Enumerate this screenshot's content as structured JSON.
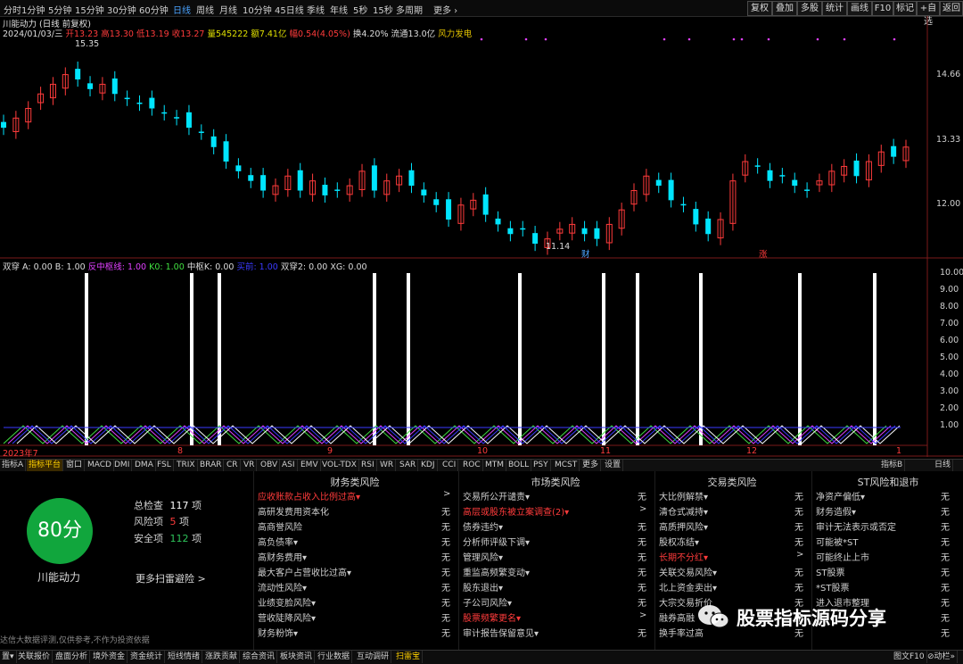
{
  "topbar": {
    "timeframes": [
      "分时",
      "1分钟",
      "5分钟",
      "15分钟",
      "30分钟",
      "60分钟",
      "日线",
      "周线",
      "月线",
      "10分钟",
      "45日线",
      "季线",
      "年线",
      "5秒",
      "15秒",
      "多周期",
      "更多 ›"
    ],
    "right_buttons": [
      "复权",
      "叠加",
      "多股",
      "统计",
      "画线",
      "F10",
      "标记",
      "+自选",
      "返回"
    ]
  },
  "header": {
    "name_line": "川能动力 (日线 前复权)",
    "date": "2024/01/03/三",
    "open_label": "开",
    "open": "13.23",
    "high_label": "高",
    "high": "13.30",
    "low_label": "低",
    "low": "13.19",
    "close_label": "收",
    "close": "13.27",
    "vol_label": "量",
    "vol": "545222",
    "amt_label": "额",
    "amt": "7.41亿",
    "chg_label": "幅",
    "chg": "0.54(4.05%)",
    "turn": "换4.20%",
    "float": "流通13.0亿",
    "concept": "风力发电"
  },
  "price_axis": [
    "14.66",
    "13.33",
    "12.00"
  ],
  "price_marks": {
    "high": "15.35",
    "low": "11.14",
    "tag_cai": "财",
    "tag_zhang": "涨"
  },
  "date_axis": [
    "2023年7",
    "8",
    "9",
    "10",
    "11",
    "12",
    "1"
  ],
  "indicator": {
    "name": "双穿",
    "legend": [
      "A: 0.00",
      "B: 1.00",
      "反中枢线: 1.00",
      "K0: 1.00",
      "中枢K: 0.00",
      "买前: 1.00",
      "双穿2: 0.00",
      "XG: 0.00"
    ],
    "axis": [
      "10.00",
      "9.00",
      "8.00",
      "7.00",
      "6.00",
      "5.00",
      "4.00",
      "3.00",
      "2.00",
      "1.00"
    ]
  },
  "tabs": [
    "指标A",
    "指标平台",
    "窗口",
    "MACD",
    "DMI",
    "DMA",
    "FSL",
    "TRIX",
    "BRAR",
    "CR",
    "VR",
    "OBV",
    "ASI",
    "EMV",
    "VOL-TDX",
    "RSI",
    "WR",
    "SAR",
    "KDJ",
    "CCI",
    "ROC",
    "MTM",
    "BOLL",
    "PSY",
    "MCST",
    "更多",
    "设置"
  ],
  "tabs_right": [
    "指标B",
    "日线"
  ],
  "risk": {
    "score": "80分",
    "company": "川能动力",
    "total_label": "总检查",
    "total": "117",
    "unit": "项",
    "risk_label": "风险项",
    "risk_count": "5",
    "safe_label": "安全项",
    "safe": "112",
    "more": "更多扫雷避险 >",
    "disclaimer": "达信大数据评测,仅供参考,不作为投资依据",
    "columns": [
      {
        "title": "财务类风险",
        "rows": [
          {
            "label": "应收账款占收入比例过高▾",
            "val": ">",
            "red": true
          },
          {
            "label": "高研发费用资本化",
            "val": "无"
          },
          {
            "label": "高商誉风险",
            "val": "无"
          },
          {
            "label": "高负债率▾",
            "val": "无"
          },
          {
            "label": "高财务费用▾",
            "val": "无"
          },
          {
            "label": "最大客户占营收比过高▾",
            "val": "无"
          },
          {
            "label": "流动性风险▾",
            "val": "无"
          },
          {
            "label": "业绩变脸风险▾",
            "val": "无"
          },
          {
            "label": "营收陡降风险▾",
            "val": "无"
          },
          {
            "label": "财务粉饰▾",
            "val": "无"
          }
        ]
      },
      {
        "title": "市场类风险",
        "rows": [
          {
            "label": "交易所公开谴责▾",
            "val": "无"
          },
          {
            "label": "高层或股东被立案调查(2)▾",
            "val": ">",
            "red": true
          },
          {
            "label": "债券违约▾",
            "val": "无"
          },
          {
            "label": "分析师评级下调▾",
            "val": "无"
          },
          {
            "label": "管理风险▾",
            "val": "无"
          },
          {
            "label": "重监高频繁变动▾",
            "val": "无"
          },
          {
            "label": "股东退出▾",
            "val": "无"
          },
          {
            "label": "子公司风险▾",
            "val": "无"
          },
          {
            "label": "股票频繁更名▾",
            "val": ">",
            "red": true
          },
          {
            "label": "审计报告保留意见▾",
            "val": "无"
          }
        ]
      },
      {
        "title": "交易类风险",
        "rows": [
          {
            "label": "大比例解禁▾",
            "val": "无"
          },
          {
            "label": "清仓式减持▾",
            "val": "无"
          },
          {
            "label": "高质押风险▾",
            "val": "无"
          },
          {
            "label": "股权冻结▾",
            "val": "无"
          },
          {
            "label": "长期不分红▾",
            "val": ">",
            "red": true
          },
          {
            "label": "关联交易风险▾",
            "val": "无"
          },
          {
            "label": "北上资金卖出▾",
            "val": "无"
          },
          {
            "label": "大宗交易折价",
            "val": "无"
          },
          {
            "label": "融券高融",
            "val": "无"
          },
          {
            "label": "换手率过高",
            "val": "无"
          }
        ]
      },
      {
        "title": "ST风险和退市",
        "rows": [
          {
            "label": "净资产偏低▾",
            "val": "无"
          },
          {
            "label": "财务造假▾",
            "val": "无"
          },
          {
            "label": "审计无法表示或否定",
            "val": "无"
          },
          {
            "label": "可能被*ST",
            "val": "无"
          },
          {
            "label": "可能终止上市",
            "val": "无"
          },
          {
            "label": "ST股票",
            "val": "无"
          },
          {
            "label": "*ST股票",
            "val": "无"
          },
          {
            "label": "进入退市整理",
            "val": "无"
          },
          {
            "label": "",
            "val": "无"
          },
          {
            "label": "",
            "val": "无"
          }
        ]
      }
    ]
  },
  "watermark": "股票指标源码分享",
  "bottombar": [
    "置▾",
    "关联报价",
    "盘面分析",
    "境外资金",
    "资金统计",
    "短线情绪",
    "涨跌贡献",
    "综合资讯",
    "板块资讯",
    "行业数据",
    "互动调研",
    "扫雷宝"
  ],
  "bottom_right": [
    "图文F10",
    "⊘动栏»"
  ],
  "colors": {
    "up": "#ff3b3b",
    "down": "#00e5ff",
    "green": "#11a63d",
    "yellow": "#ffd000"
  }
}
